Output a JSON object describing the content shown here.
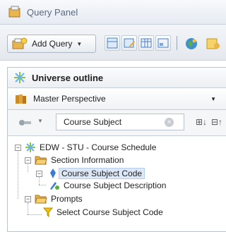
{
  "window": {
    "title": "Query Panel"
  },
  "toolbar": {
    "add_query_label": "Add Query"
  },
  "outline": {
    "title": "Universe outline",
    "perspective": "Master Perspective",
    "search_value": "Course Subject"
  },
  "tree": {
    "root": "EDW - STU - Course Schedule",
    "section": "Section Information",
    "item_code": "Course Subject Code",
    "item_desc": "Course Subject Description",
    "prompts": "Prompts",
    "prompt_item": "Select Course Subject Code"
  },
  "colors": {
    "folder": "#e8b24a",
    "dimension": "#3a7bd5",
    "prompt": "#f2c200",
    "selection": "#dce8f7"
  }
}
